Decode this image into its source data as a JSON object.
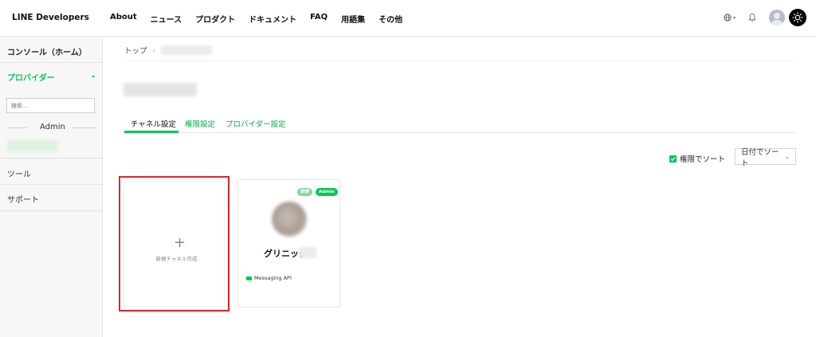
{
  "header": {
    "brand": "LINE Developers",
    "nav": [
      "About",
      "ニュース",
      "プロダクト",
      "ドキュメント",
      "FAQ",
      "用語集",
      "その他"
    ],
    "icons": [
      "globe-icon",
      "bell-icon",
      "user-avatar",
      "theme-toggle-icon"
    ]
  },
  "sidebar": {
    "console": "コンソール（ホーム）",
    "provider": "プロバイダー",
    "search_placeholder": "検索...",
    "admin_label": "Admin",
    "tool": "ツール",
    "support": "サポート"
  },
  "main": {
    "breadcrumb_home": "トップ",
    "tabs": [
      "チャネル設定",
      "権限設定",
      "プロバイダー設定"
    ],
    "sort_checkbox_label": "権限でソート",
    "sort_select_value": "日付でソート",
    "new_channel_label": "新規チャネル作成",
    "channel": {
      "badge_new": "新規",
      "badge_admin": "Admin",
      "name": "グリニッジ",
      "type": "Messaging API"
    }
  },
  "colors": {
    "accent": "#06c755",
    "highlight_border": "#e0242a"
  }
}
